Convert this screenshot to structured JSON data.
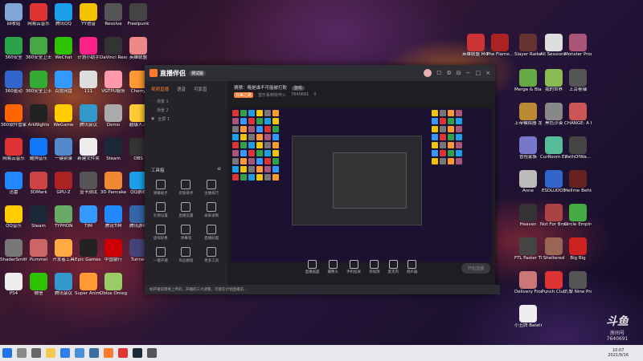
{
  "desktop": {
    "left_icons": [
      {
        "label": "回收站",
        "color": "#7fa8d6"
      },
      {
        "label": "网易云音乐",
        "color": "#d33"
      },
      {
        "label": "腾讯QQ",
        "color": "#19a0e8"
      },
      {
        "label": "YY语音",
        "color": "#f2c400"
      },
      {
        "label": "Resolve",
        "color": "#555"
      },
      {
        "label": "Freelpunk",
        "color": "#444"
      },
      {
        "label": "360安全",
        "color": "#2ca24a"
      },
      {
        "label": "360安全卫士",
        "color": "#47a843"
      },
      {
        "label": "WeChat",
        "color": "#2dc100"
      },
      {
        "label": "计划小助手",
        "color": "#f28"
      },
      {
        "label": "DaVinci Resol...",
        "color": "#333"
      },
      {
        "label": "英雄联盟",
        "color": "#e88"
      },
      {
        "label": "360驱动",
        "color": "#36c"
      },
      {
        "label": "360安全卫士",
        "color": "#3a3"
      },
      {
        "label": "百度网盘",
        "color": "#39f"
      },
      {
        "label": "111",
        "color": "#ddd"
      },
      {
        "label": "VGTPU服务",
        "color": "#f9a"
      },
      {
        "label": "Cherry",
        "color": "#f93"
      },
      {
        "label": "360软件管家",
        "color": "#f60"
      },
      {
        "label": "ArkNights",
        "color": "#222"
      },
      {
        "label": "WeGame",
        "color": "#fc0"
      },
      {
        "label": "腾讯会议",
        "color": "#39c"
      },
      {
        "label": "Demo",
        "color": "#aaa"
      },
      {
        "label": "超级人人",
        "color": "#fc3"
      },
      {
        "label": "网易云音乐",
        "color": "#d33"
      },
      {
        "label": "酷狗音乐",
        "color": "#17f"
      },
      {
        "label": "一键刻录",
        "color": "#58c"
      },
      {
        "label": "新建文件夹",
        "color": "#eee"
      },
      {
        "label": "Steam",
        "color": "#1b2838"
      },
      {
        "label": "OBS",
        "color": "#333"
      },
      {
        "label": "迅雷",
        "color": "#28f"
      },
      {
        "label": "3DMark",
        "color": "#c44"
      },
      {
        "label": "GPU-Z",
        "color": "#a22"
      },
      {
        "label": "显卡测试",
        "color": "#555"
      },
      {
        "label": "3D Pancake",
        "color": "#e83"
      },
      {
        "label": "QQ游戏",
        "color": "#19a0e8"
      },
      {
        "label": "QQ音乐",
        "color": "#fc0"
      },
      {
        "label": "Steam",
        "color": "#1b2838"
      },
      {
        "label": "TYPHON",
        "color": "#6a6"
      },
      {
        "label": "TIM",
        "color": "#39f"
      },
      {
        "label": "腾讯TIM",
        "color": "#28f"
      },
      {
        "label": "腾讯游戏",
        "color": "#36a"
      },
      {
        "label": "ShaderSmith",
        "color": "#777"
      },
      {
        "label": "Pummel",
        "color": "#c66"
      },
      {
        "label": "开发者工具",
        "color": "#fa4"
      },
      {
        "label": "Epic Games Launcher",
        "color": "#222"
      },
      {
        "label": "中国银行",
        "color": "#c00"
      },
      {
        "label": "Tunnel",
        "color": "#447"
      },
      {
        "label": "PS4",
        "color": "#eee"
      },
      {
        "label": "微信",
        "color": "#2dc100"
      },
      {
        "label": "腾讯会议",
        "color": "#39c"
      },
      {
        "label": "Super Anim...",
        "color": "#f93"
      },
      {
        "label": "Oblox Omega",
        "color": "#9c6"
      }
    ],
    "right_icons": [
      {
        "label": "英雄联盟 Mortal...",
        "color": "#c33"
      },
      {
        "label": "The Flame...",
        "color": "#a22"
      },
      {
        "label": "Slayer Raiken...",
        "color": "#633"
      },
      {
        "label": "All Sessions Reanimated",
        "color": "#ddd"
      },
      {
        "label": "Monster Prom",
        "color": "#a57"
      },
      {
        "label": "Merge & Blade",
        "color": "#6a4"
      },
      {
        "label": "我的世界",
        "color": "#8b5"
      },
      {
        "label": "上古卷轴",
        "color": "#555"
      },
      {
        "label": "上帝模拟器 龙之...",
        "color": "#b83"
      },
      {
        "label": "黑色沙漠",
        "color": "#888"
      },
      {
        "label": "CHANGE: A Homeless...",
        "color": "#c55"
      },
      {
        "label": "冒险家族",
        "color": "#77c"
      },
      {
        "label": "CurRoom Expedition",
        "color": "#5b9"
      },
      {
        "label": "PathOfWa...",
        "color": "#444"
      },
      {
        "label": "Anne",
        "color": "#bbb"
      },
      {
        "label": "ESDLUDOS",
        "color": "#36c"
      },
      {
        "label": "Hellme Behind",
        "color": "#622"
      },
      {
        "label": "Heaven",
        "color": "#333"
      },
      {
        "label": "Not For Broadcast",
        "color": "#a44"
      },
      {
        "label": "Circle Empires",
        "color": "#4a4"
      },
      {
        "label": "FTL Faster Than Light",
        "color": "#444"
      },
      {
        "label": "Sheltered",
        "color": "#965"
      },
      {
        "label": "Big Big",
        "color": "#c22"
      },
      {
        "label": "Delivery From The...",
        "color": "#c77"
      },
      {
        "label": "Punch Club",
        "color": "#d33"
      },
      {
        "label": "九黎 Nine Prov...",
        "color": "#555"
      },
      {
        "label": "小丑牌 Balatro...",
        "color": "#eee"
      }
    ]
  },
  "app": {
    "name": "直播伴侣",
    "badge": "测试版",
    "tabs": [
      "视频直播",
      "语音",
      "可靠直"
    ],
    "scenes": [
      "场景 1",
      "场景 2",
      "全屏 1"
    ],
    "tools_title": "工具箱",
    "tools": [
      "弹幕助手",
      "房管助手",
      "主播排行",
      "礼物设置",
      "直播设置",
      "录屏录制",
      "虚拟形象",
      "弹幕墙",
      "直播助理",
      "一键开播",
      "商品橱窗",
      "更多工具"
    ],
    "room_title": "猜猜：俺是谁不可能被打败",
    "room_badge": "游戏",
    "room_tag": "完美之路",
    "room_meta": "音乐系到协作入",
    "room_id": "7640691",
    "room_fans": "0",
    "bottom_buttons": [
      "直播画面",
      "摄像头",
      "手机投屏",
      "添加源",
      "麦克风",
      "扬声器"
    ],
    "start_label": "开始直播",
    "status_text": "如开播前需要上传的，开播的三大调整，可能在计划直播前...",
    "window_controls": [
      "☐",
      "⚙",
      "⊟",
      "−",
      "□",
      "×"
    ]
  },
  "taskbar": {
    "time": "10:07",
    "date": "2021/9/16"
  },
  "watermark": {
    "logo": "斗鱼",
    "room_label": "房间号",
    "room_id": "7640691"
  }
}
